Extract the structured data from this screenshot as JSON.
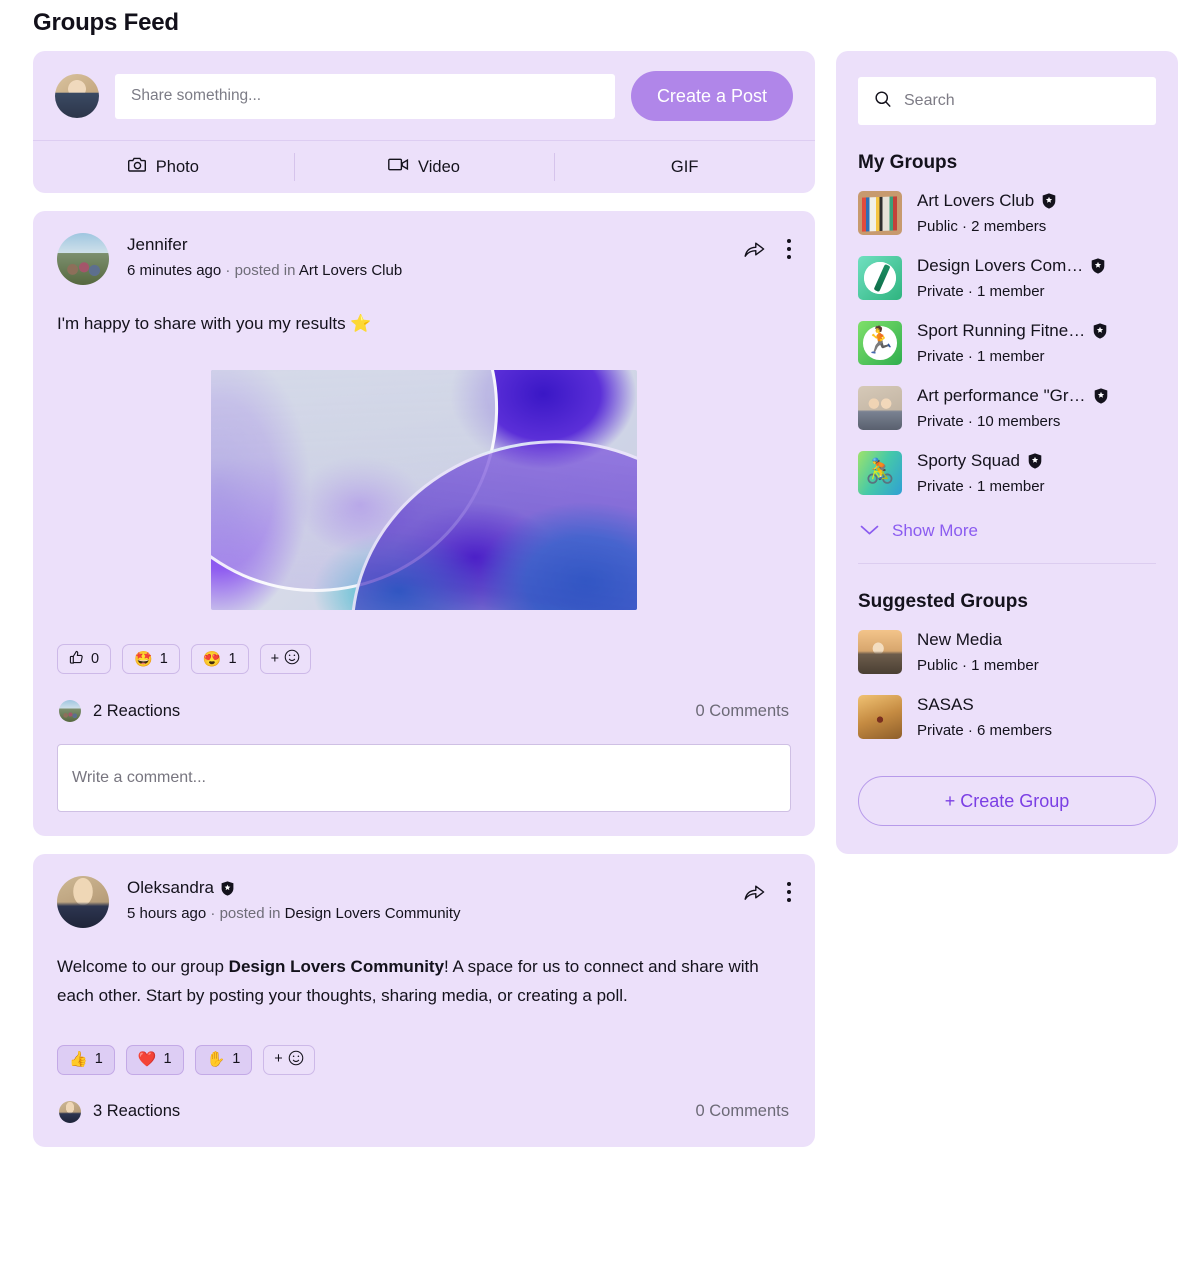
{
  "page": {
    "title": "Groups Feed"
  },
  "composer": {
    "placeholder": "Share something...",
    "create_post_label": "Create a Post",
    "actions": [
      {
        "label": "Photo",
        "icon": "camera-icon"
      },
      {
        "label": "Video",
        "icon": "video-camera-icon"
      },
      {
        "label": "GIF",
        "icon": "gif-icon"
      }
    ]
  },
  "posts": [
    {
      "author": "Jennifer",
      "verified": false,
      "time": "6 minutes ago",
      "separator": "·",
      "posted_in_label": "posted in",
      "group": "Art Lovers Club",
      "text": "I'm happy to share with you my results ⭐",
      "has_image": true,
      "reactions": [
        {
          "emoji": "thumbs-up-outline",
          "glyph": "👍",
          "count": "0",
          "selected": false,
          "outline": true
        },
        {
          "emoji": "star-struck",
          "glyph": "🤩",
          "count": "1",
          "selected": false,
          "outline": false
        },
        {
          "emoji": "heart-eyes",
          "glyph": "😍",
          "count": "1",
          "selected": false,
          "outline": false
        }
      ],
      "add_reaction_label": "+",
      "reactions_summary": "2 Reactions",
      "comments_summary": "0 Comments",
      "comment_placeholder": "Write a comment...",
      "show_comment_box": true
    },
    {
      "author": "Oleksandra",
      "verified": true,
      "time": "5 hours ago",
      "separator": "·",
      "posted_in_label": "posted in",
      "group": "Design Lovers Community",
      "text_before": "Welcome to our group ",
      "text_bold": "Design Lovers Community",
      "text_after": "! A space for us to connect and share with each other. Start by posting your thoughts, sharing media, or creating a poll.",
      "has_image": false,
      "reactions": [
        {
          "emoji": "thumbs-up",
          "glyph": "👍",
          "count": "1",
          "selected": true,
          "outline": false
        },
        {
          "emoji": "red-heart",
          "glyph": "❤️",
          "count": "1",
          "selected": true,
          "outline": false
        },
        {
          "emoji": "raised-hand",
          "glyph": "✋",
          "count": "1",
          "selected": true,
          "outline": false
        }
      ],
      "add_reaction_label": "+",
      "reactions_summary": "3 Reactions",
      "comments_summary": "0 Comments",
      "comment_placeholder": "Write a comment...",
      "show_comment_box": false
    }
  ],
  "sidebar": {
    "search": {
      "placeholder": "Search",
      "value": ""
    },
    "my_groups_heading": "My Groups",
    "my_groups": [
      {
        "name": "Art Lovers Club",
        "sub": "Public · 2 members",
        "badge": true,
        "thumb": "g-art"
      },
      {
        "name": "Design Lovers Com…",
        "sub": "Private · 1 member",
        "badge": true,
        "thumb": "g-design"
      },
      {
        "name": "Sport Running Fitne…",
        "sub": "Private · 1 member",
        "badge": true,
        "thumb": "g-run"
      },
      {
        "name": "Art performance \"Gr…",
        "sub": "Private · 10 members",
        "badge": true,
        "thumb": "g-perf"
      },
      {
        "name": "Sporty Squad",
        "sub": "Private · 1 member",
        "badge": true,
        "thumb": "g-sporty"
      }
    ],
    "show_more_label": "Show More",
    "suggested_heading": "Suggested Groups",
    "suggested_groups": [
      {
        "name": "New Media",
        "sub": "Public · 1 member",
        "badge": false,
        "thumb": "g-newmedia"
      },
      {
        "name": "SASAS",
        "sub": "Private · 6 members",
        "badge": false,
        "thumb": "g-sasas"
      }
    ],
    "create_group_label": "+ Create Group"
  },
  "colors": {
    "card_bg": "#ECE0FA",
    "accent_purple": "#B086E9",
    "link_purple": "#8B5CF0",
    "page_bg": "#FFFFFF"
  }
}
